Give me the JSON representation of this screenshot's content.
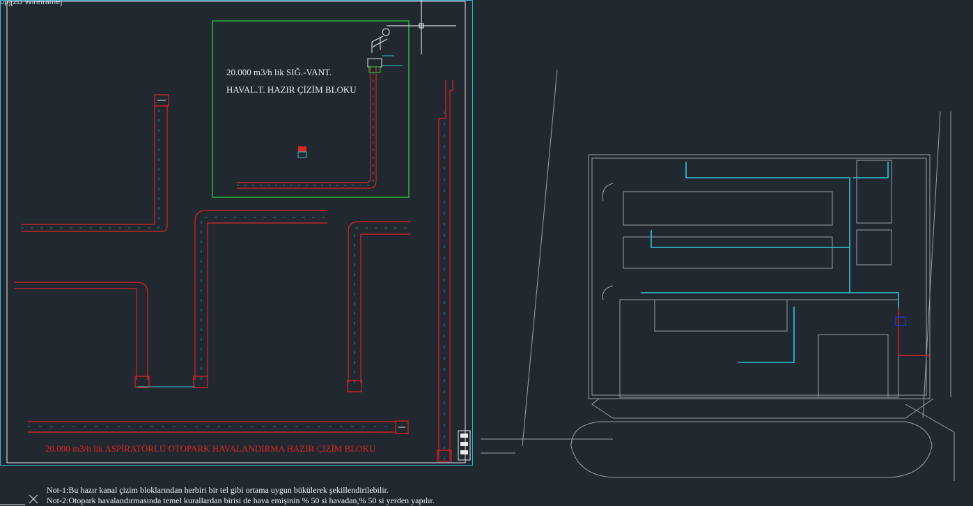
{
  "viewport": {
    "label": "op][2D Wireframe]"
  },
  "supply_block": {
    "title_line1": "20.000 m3/h lik SIĞ.-VANT.",
    "title_line2": "HAVAL.T. HAZIR ÇİZİM BLOKU"
  },
  "exhaust_block": {
    "title": "20.000 m3/h lik ASPİRATÖRLÜ OTOPARK HAVALANDIRMA HAZIR ÇİZİM BLOKU"
  },
  "notes": {
    "note1": "Not-1:Bu hazır  kanal çizim bloklarından herbiri bir tel gibi ortama uygun bükülerek şekillendirilebilir.",
    "note2": "Not-2:Otopark havalandırmasında temel kurallardan birisi de hava emişinin % 50 si havadan,% 50 si yerden yapılır."
  },
  "colors": {
    "background": "#212830",
    "viewport_border": "#3fb6d8",
    "duct_red": "#e02424",
    "duct_cyan": "#34c6d6",
    "block_green": "#2ecc40",
    "floorplan_line": "#9aa1a8",
    "crosshair": "#ffffff"
  },
  "icons": {
    "crosshair": "crosshair-cursor-icon",
    "ucs": "ucs-cross-icon",
    "fan": "fan-unit-icon"
  }
}
